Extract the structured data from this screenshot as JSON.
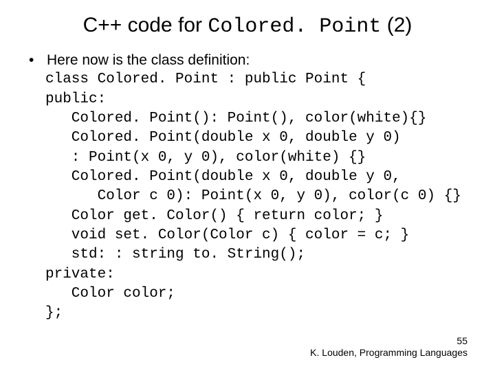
{
  "title": {
    "pre": "C++ code for ",
    "mono": "Colored. Point",
    "post": " (2)"
  },
  "bullet": "Here now is the class definition:",
  "code": {
    "l01": "class Colored. Point : public Point {",
    "l02": "public:",
    "l03": "   Colored. Point(): Point(), color(white){}",
    "l04": "   Colored. Point(double x 0, double y 0)",
    "l05": "   : Point(x 0, y 0), color(white) {}",
    "l06": "   Colored. Point(double x 0, double y 0,",
    "l07": "      Color c 0): Point(x 0, y 0), color(c 0) {}",
    "l08": "   Color get. Color() { return color; }",
    "l09": "   void set. Color(Color c) { color = c; }",
    "l10": "   std: : string to. String();",
    "l11": "private:",
    "l12": "   Color color;",
    "l13": "};"
  },
  "footer": {
    "page": "55",
    "credit": "K. Louden, Programming Languages"
  }
}
